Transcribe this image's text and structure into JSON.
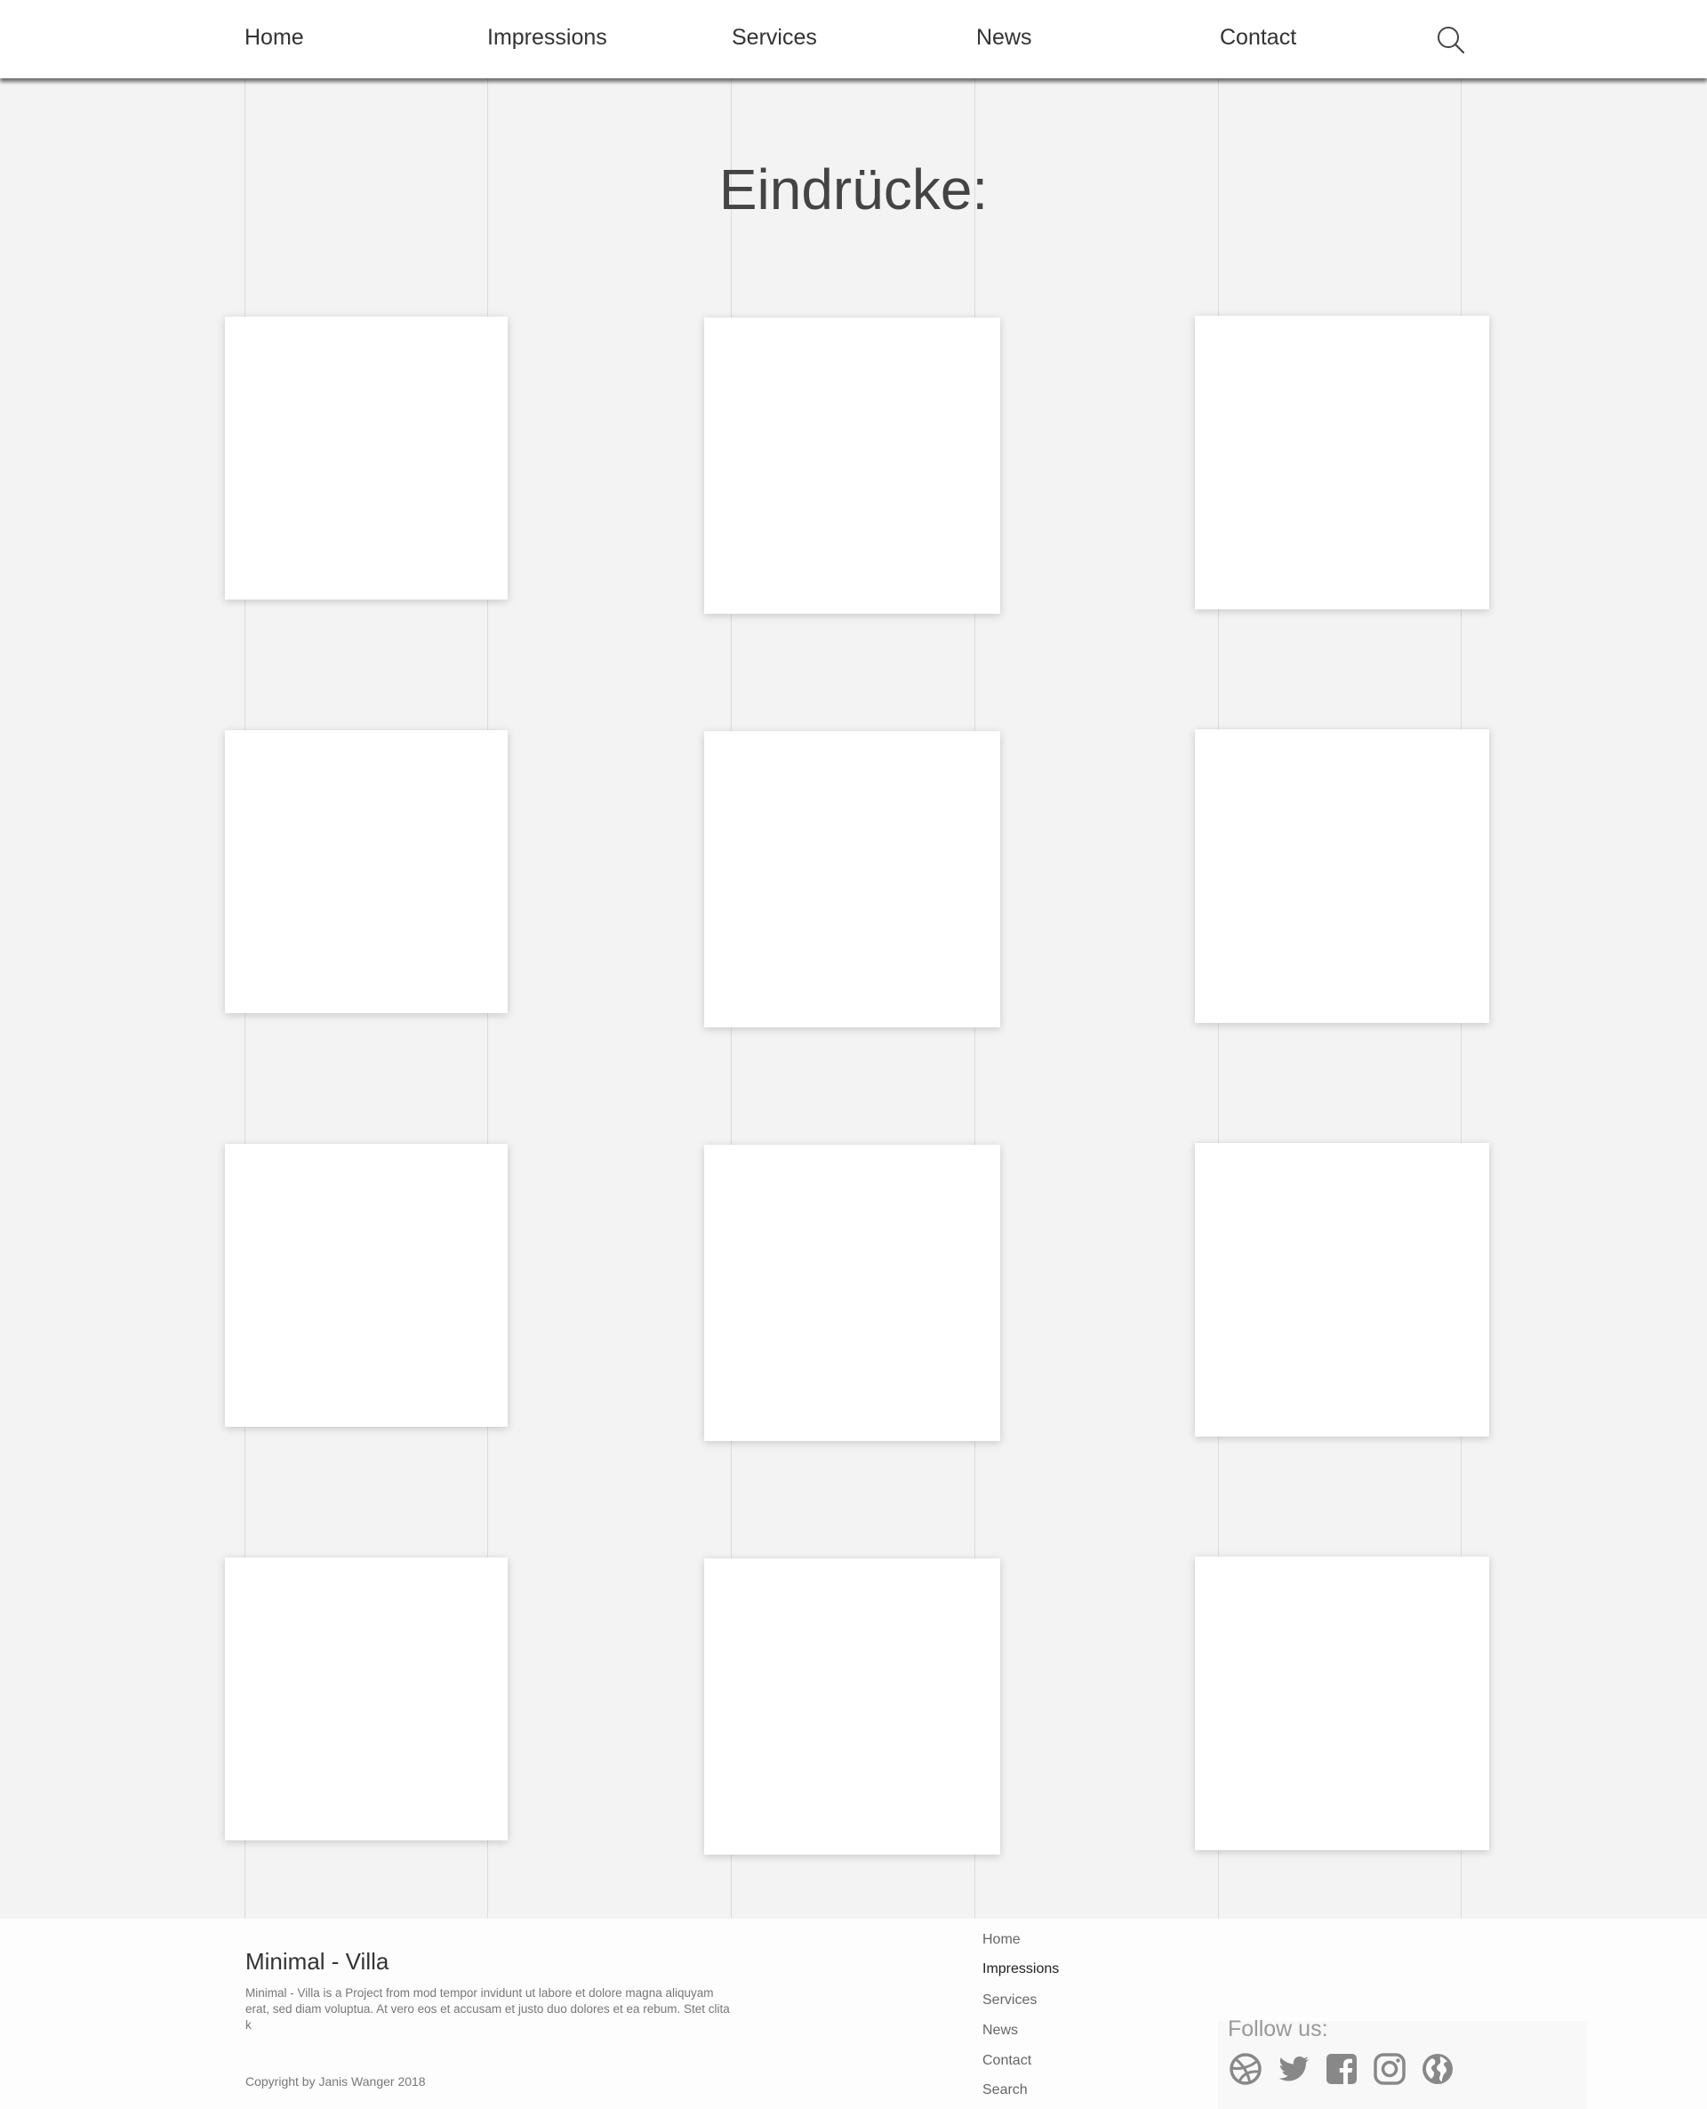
{
  "nav": {
    "items": [
      {
        "label": "Home"
      },
      {
        "label": "Impressions"
      },
      {
        "label": "Services"
      },
      {
        "label": "News"
      },
      {
        "label": "Contact"
      }
    ],
    "search_icon": "search-icon"
  },
  "page": {
    "title": "Eindrücke:"
  },
  "gallery": {
    "tile_count": 12
  },
  "footer": {
    "brand": "Minimal - Villa",
    "description": "Minimal - Villa  is a Project from mod tempor invidunt ut labore et dolore magna aliquyam erat, sed diam voluptua. At vero eos et accusam et justo duo dolores et ea rebum. Stet clita k",
    "copyright": "Copyright by Janis Wanger 2018",
    "links": [
      {
        "label": "Home",
        "active": false
      },
      {
        "label": "Impressions",
        "active": true
      },
      {
        "label": "Services",
        "active": false
      },
      {
        "label": "News",
        "active": false
      },
      {
        "label": "Contact",
        "active": false
      },
      {
        "label": "Search",
        "active": false
      }
    ],
    "follow_title": "Follow us:",
    "social_icons": [
      "dribbble-icon",
      "twitter-icon",
      "facebook-icon",
      "instagram-icon",
      "globe-icon"
    ],
    "icon_color": "#888888"
  }
}
